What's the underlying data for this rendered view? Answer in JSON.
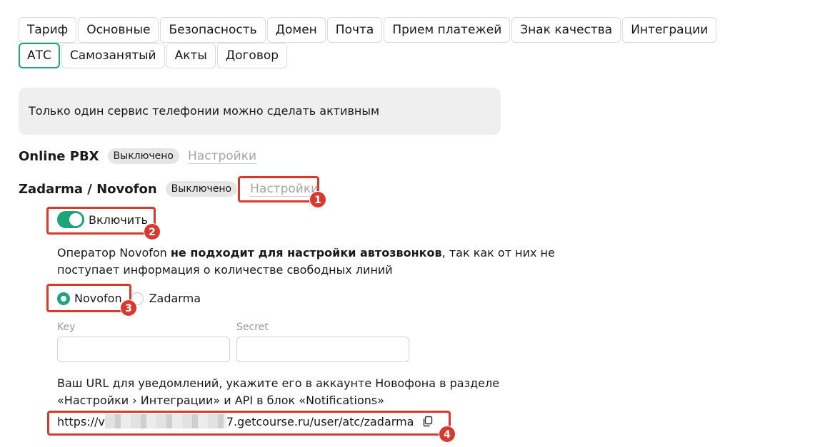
{
  "tabs_row1": [
    "Тариф",
    "Основные",
    "Безопасность",
    "Домен",
    "Почта",
    "Прием платежей",
    "Знак качества",
    "Интеграции"
  ],
  "tabs_row2": [
    "АТС",
    "Самозанятый",
    "Акты",
    "Договор"
  ],
  "active_tab": "АТС",
  "info_text": "Только один сервис телефонии можно сделать активным",
  "services": [
    {
      "name": "Online PBX",
      "status": "Выключено",
      "settings": "Настройки"
    },
    {
      "name": "Zadarma / Novofon",
      "status": "Выключено",
      "settings": "Настройки"
    }
  ],
  "toggle_label": "Включить",
  "toggle_on": true,
  "operator_note": {
    "part1": "Оператор Novofon ",
    "bold": "не подходит для настройки автозвонков",
    "part2": ", так как от них не поступает информация о количестве свободных линий"
  },
  "operators": [
    {
      "label": "Novofon",
      "checked": true
    },
    {
      "label": "Zadarma",
      "checked": false
    }
  ],
  "fields": {
    "key_label": "Key",
    "secret_label": "Secret",
    "key_value": "",
    "secret_value": ""
  },
  "url_note": "Ваш URL для уведомлений, укажите его в аккаунте Новофона в разделе «Настройки › Интеграции» и API в блок «Notifications»",
  "url_prefix": "https://v",
  "url_suffix": "7.getcourse.ru/user/atc/zadarma",
  "markers": [
    "1",
    "2",
    "3",
    "4"
  ],
  "colors": {
    "accent": "#1ea47a",
    "marker": "#d93a30"
  }
}
